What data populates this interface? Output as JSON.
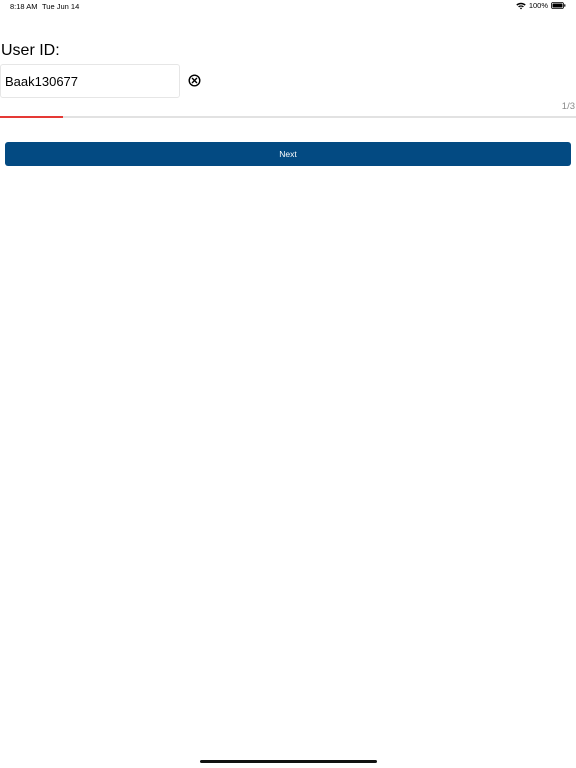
{
  "status_bar": {
    "time": "8:18 AM",
    "date": "Tue Jun 14",
    "battery_text": "100%",
    "icons": [
      "wifi-icon",
      "battery-icon"
    ]
  },
  "form": {
    "user_id_label": "User ID:",
    "user_id_value": "Baak130677",
    "clear_icon": "clear-circle-x-icon"
  },
  "progress": {
    "counter_text": "1/3",
    "current_step": 1,
    "total_steps": 3,
    "fill_fraction": 0.11,
    "fill_color": "#e53935",
    "track_color": "#e2e2e2"
  },
  "actions": {
    "next_label": "Next",
    "next_color": "#034a82"
  }
}
